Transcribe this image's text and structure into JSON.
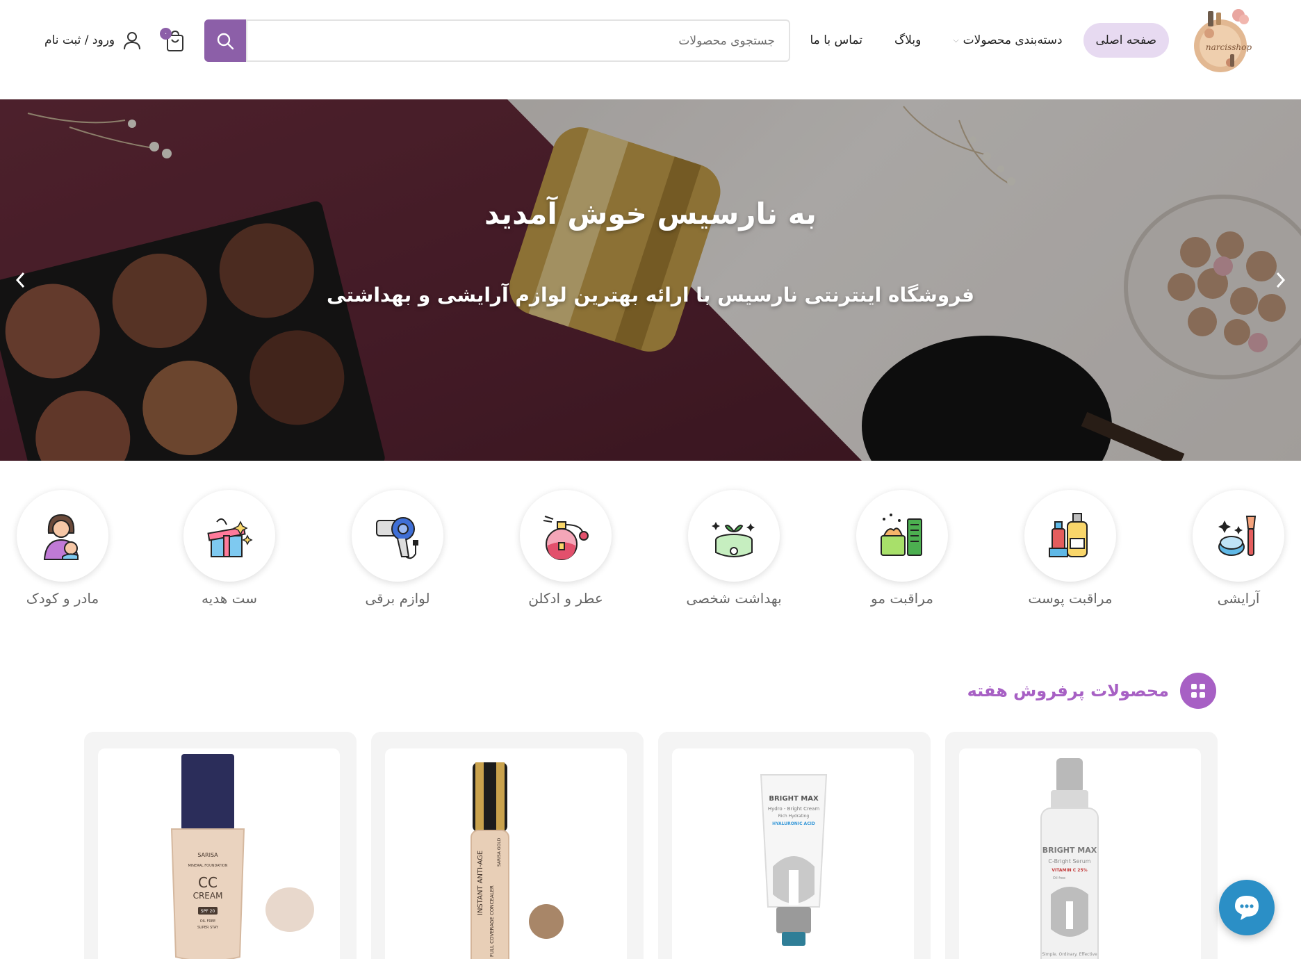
{
  "brand": {
    "logo_text": "narcisshop",
    "accent": "#8c5fa8",
    "highlight": "#a760c4",
    "nav_active_bg": "#e7daf1"
  },
  "nav": {
    "items": [
      {
        "label": "صفحه اصلی",
        "active": true
      },
      {
        "label": "دسته‌بندی محصولات",
        "has_dropdown": true
      },
      {
        "label": "وبلاگ"
      },
      {
        "label": "تماس با ما"
      }
    ]
  },
  "search": {
    "placeholder": "جستجوی محصولات",
    "icon": "search-icon"
  },
  "cart": {
    "count": "۰",
    "icon": "shopping-bag-icon"
  },
  "account": {
    "label": "ورود / ثبت نام",
    "icon": "user-icon"
  },
  "hero": {
    "title": "به نارسیس خوش آمدید",
    "subtitle": "فروشگاه اینترنتی نارسیس با ارائه بهترین لوازم آرایشی و بهداشتی",
    "prev_icon": "chevron-left-icon",
    "next_icon": "chevron-right-icon"
  },
  "categories": [
    {
      "label": "آرایشی",
      "icon": "makeup-icon"
    },
    {
      "label": "مراقبت پوست",
      "icon": "skincare-icon"
    },
    {
      "label": "مراقبت مو",
      "icon": "haircare-icon"
    },
    {
      "label": "بهداشت شخصی",
      "icon": "personal-hygiene-icon"
    },
    {
      "label": "عطر و ادکلن",
      "icon": "perfume-icon"
    },
    {
      "label": "لوازم برقی",
      "icon": "hair-dryer-icon"
    },
    {
      "label": "ست هدیه",
      "icon": "gift-icon"
    },
    {
      "label": "مادر و کودک",
      "icon": "mother-child-icon"
    }
  ],
  "best_sellers": {
    "title": "محصولات پرفروش هفته",
    "icon": "grid-icon",
    "products": [
      {
        "name": "BRIGHT MAX C-Bright Serum",
        "brand": "BRIGHT MAX",
        "line1": "C-Bright Serum",
        "line2": "VITAMIN C 25%",
        "line3": "Oil free",
        "footer": "Simple. Ordinary. Effective"
      },
      {
        "name": "BRIGHT MAX Hydro-Bright Cream",
        "brand": "BRIGHT MAX",
        "line1": "Hydro - Bright Cream",
        "line2": "Rich Hydrating",
        "line3": "HYALURONIC ACID"
      },
      {
        "name": "Sarisa Instant Anti-Age Full Coverage Concealer",
        "brand": "SARISA GOLD",
        "line1": "INSTANT ANTI-AGE",
        "line2": "FULL COVERAGE CONCEALER",
        "swatch": "#a88668"
      },
      {
        "name": "Sarisa CC Cream Mineral Foundation",
        "brand": "SARISA",
        "line1": "MINERAL FOUNDATION",
        "line2": "CC",
        "line3": "CREAM",
        "line4": "SPF 20",
        "line5": "OIL FREE",
        "line6": "SUPER STAY",
        "swatch": "#e8d8cc"
      }
    ]
  },
  "chat": {
    "icon": "chat-icon"
  }
}
